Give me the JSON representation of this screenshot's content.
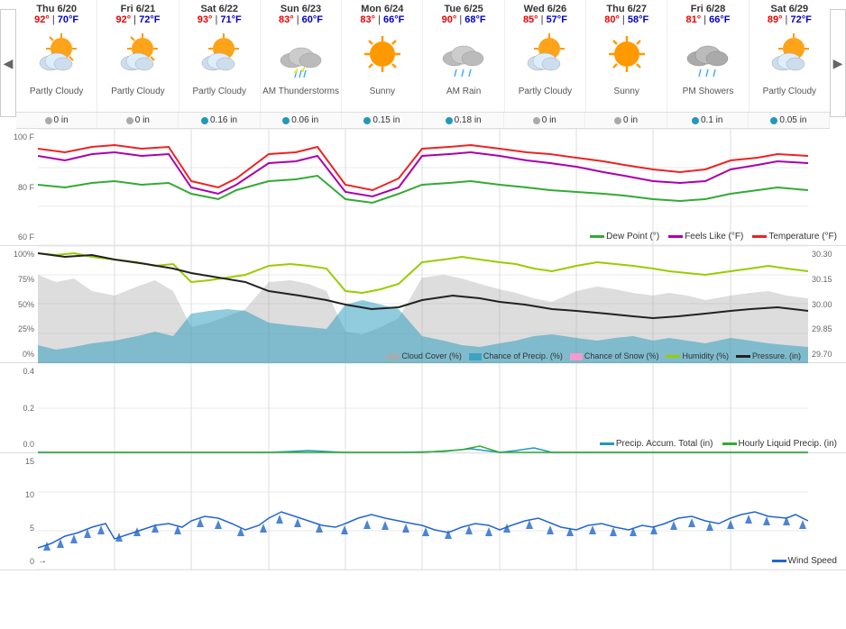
{
  "nav": {
    "prev": "◀",
    "next": "▶"
  },
  "days": [
    {
      "name": "Thu 6/20",
      "high": "92°",
      "low": "70°F",
      "condition": "Partly Cloudy",
      "precip": "0 in",
      "precipType": "gray",
      "iconType": "sun-cloud"
    },
    {
      "name": "Fri 6/21",
      "high": "92°",
      "low": "72°F",
      "condition": "Partly Cloudy",
      "precip": "0 in",
      "precipType": "gray",
      "iconType": "sun-cloud"
    },
    {
      "name": "Sat 6/22",
      "high": "93°",
      "low": "71°F",
      "condition": "Partly Cloudy",
      "precip": "0.16 in",
      "precipType": "blue",
      "iconType": "sun-cloud"
    },
    {
      "name": "Sun 6/23",
      "high": "83°",
      "low": "60°F",
      "condition": "AM Thunderstorms",
      "precip": "0.06 in",
      "precipType": "blue",
      "iconType": "thunder"
    },
    {
      "name": "Mon 6/24",
      "high": "83°",
      "low": "66°F",
      "condition": "Sunny",
      "precip": "0.15 in",
      "precipType": "blue",
      "iconType": "sun"
    },
    {
      "name": "Tue 6/25",
      "high": "90°",
      "low": "68°F",
      "condition": "AM Rain",
      "precip": "0.18 in",
      "precipType": "blue",
      "iconType": "rain-cloud"
    },
    {
      "name": "Wed 6/26",
      "high": "85°",
      "low": "57°F",
      "condition": "Partly Cloudy",
      "precip": "0 in",
      "precipType": "gray",
      "iconType": "sun-cloud"
    },
    {
      "name": "Thu 6/27",
      "high": "80°",
      "low": "58°F",
      "condition": "Sunny",
      "precip": "0 in",
      "precipType": "gray",
      "iconType": "sun"
    },
    {
      "name": "Fri 6/28",
      "high": "81°",
      "low": "66°F",
      "condition": "PM Showers",
      "precip": "0.1 in",
      "precipType": "blue",
      "iconType": "rain-cloud"
    },
    {
      "name": "Sat 6/29",
      "high": "89°",
      "low": "72°F",
      "condition": "Partly Cloudy",
      "precip": "0.05 in",
      "precipType": "blue",
      "iconType": "sun-cloud"
    }
  ],
  "chart1": {
    "yLabels": [
      "100 F",
      "80 F",
      "60 F"
    ],
    "legend": [
      {
        "label": "Dew Point (°)",
        "color": "#3a3"
      },
      {
        "label": "Feels Like (°F)",
        "color": "#a0a"
      },
      {
        "label": "Temperature (°F)",
        "color": "#e22"
      }
    ]
  },
  "chart2": {
    "yLabelsLeft": [
      "100%",
      "75%",
      "50%",
      "25%",
      "0%"
    ],
    "yLabelsRight": [
      "30.30",
      "30.15",
      "30.00",
      "29.85",
      "29.70"
    ],
    "legend": [
      {
        "label": "Cloud Cover (%)",
        "color": "#aaa"
      },
      {
        "label": "Chance of Precip. (%)",
        "color": "#29b"
      },
      {
        "label": "Chance of Snow (%)",
        "color": "#f9c"
      },
      {
        "label": "Humidity (%)",
        "color": "#9c0"
      },
      {
        "label": "Pressure. (in)",
        "color": "#000"
      }
    ]
  },
  "chart3": {
    "yLabels": [
      "0.4",
      "0.2",
      "0.0"
    ],
    "legend": [
      {
        "label": "Precip. Accum. Total (in)",
        "color": "#29b"
      },
      {
        "label": "Hourly Liquid Precip. (in)",
        "color": "#3a3"
      }
    ]
  },
  "chart4": {
    "yLabels": [
      "15",
      "10",
      "5",
      "0"
    ],
    "legend": [
      {
        "label": "Wind Speed",
        "color": "#2266cc"
      }
    ],
    "bottomLabel": "→"
  }
}
